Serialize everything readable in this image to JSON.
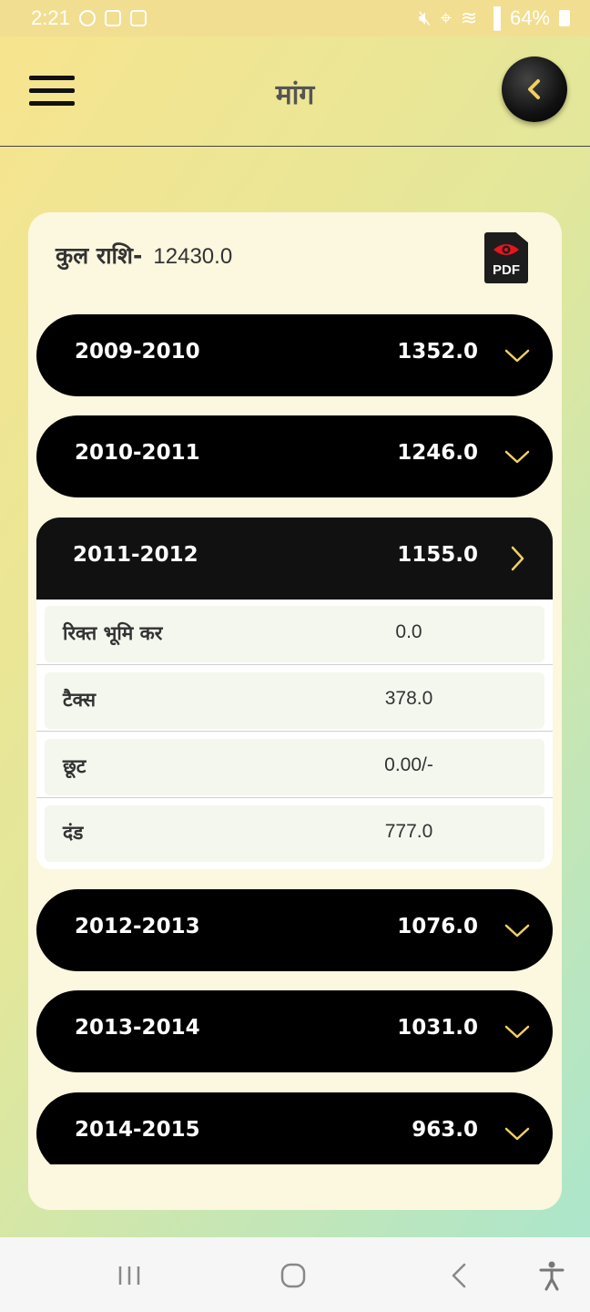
{
  "status_bar": {
    "time": "2:21",
    "battery": "64%"
  },
  "app_bar": {
    "title": "मांग",
    "menu_icon": "hamburger-menu-icon",
    "back_icon": "chevron-left-icon"
  },
  "summary": {
    "total_label": "कुल राशि-",
    "total_value": "12430.0",
    "pdf_label": "PDF"
  },
  "years": [
    {
      "period": "2009-2010",
      "amount": "1352.0",
      "expanded": false
    },
    {
      "period": "2010-2011",
      "amount": "1246.0",
      "expanded": false
    },
    {
      "period": "2011-2012",
      "amount": "1155.0",
      "expanded": true
    },
    {
      "period": "2012-2013",
      "amount": "1076.0",
      "expanded": false
    },
    {
      "period": "2013-2014",
      "amount": "1031.0",
      "expanded": false
    },
    {
      "period": "2014-2015",
      "amount": "963.0",
      "expanded": false
    }
  ],
  "details": [
    {
      "label": "रिक्त भूमि कर",
      "value": "0.0"
    },
    {
      "label": "टैक्स",
      "value": "378.0"
    },
    {
      "label": "छूट",
      "value": "0.00/-"
    },
    {
      "label": "दंड",
      "value": "777.0"
    }
  ],
  "colors": {
    "accent_gold": "#f0d060",
    "row_black": "#000000",
    "card_bg": "#fcf7df",
    "pdf_red": "#e8141c"
  }
}
